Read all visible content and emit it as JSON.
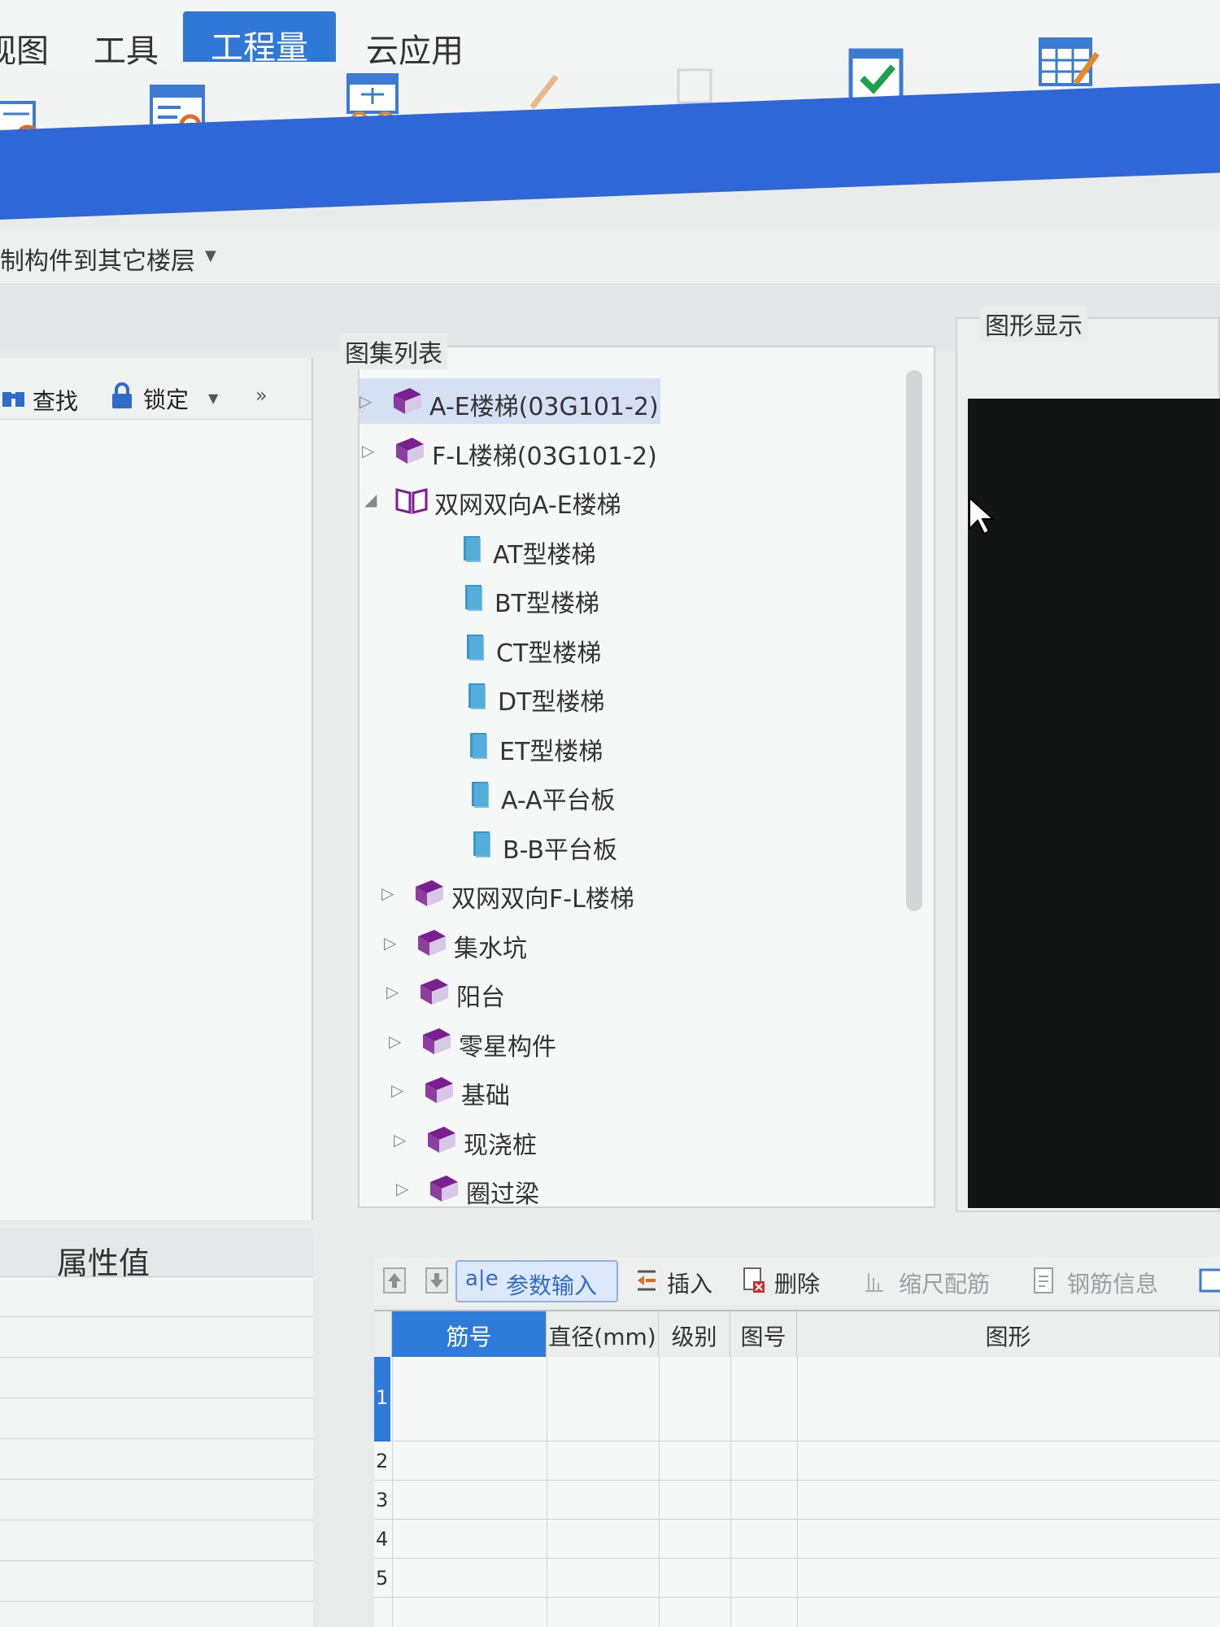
{
  "menu": {
    "items": [
      {
        "label": "视图"
      },
      {
        "label": "工具"
      },
      {
        "label": "工程量"
      },
      {
        "label": "云应用"
      }
    ]
  },
  "toolbar": {
    "icons": [
      "find-drawing-icon",
      "query-table-icon",
      "calculator-glasses-icon",
      "pencil-icon",
      "blank-icon",
      "check-icon",
      "table-edit-icon"
    ]
  },
  "copy_row": {
    "label": "制构件到其它楼层"
  },
  "left_panel": {
    "find_label": "查找",
    "lock_label": "锁定"
  },
  "attribute_panel": {
    "title": "属性值"
  },
  "atlas": {
    "title": "图集列表",
    "items": [
      {
        "label": "A-E楼梯(03G101-2)",
        "expanded": false,
        "selected": true
      },
      {
        "label": "F-L楼梯(03G101-2)",
        "expanded": false
      },
      {
        "label": "双网双向A-E楼梯",
        "expanded": true,
        "children": [
          {
            "label": "AT型楼梯"
          },
          {
            "label": "BT型楼梯"
          },
          {
            "label": "CT型楼梯"
          },
          {
            "label": "DT型楼梯"
          },
          {
            "label": "ET型楼梯"
          },
          {
            "label": "A-A平台板"
          },
          {
            "label": "B-B平台板"
          }
        ]
      },
      {
        "label": "双网双向F-L楼梯",
        "expanded": false
      },
      {
        "label": "集水坑",
        "expanded": false
      },
      {
        "label": "阳台",
        "expanded": false
      },
      {
        "label": "零星构件",
        "expanded": false
      },
      {
        "label": "基础",
        "expanded": false
      },
      {
        "label": "现浇桩",
        "expanded": false
      },
      {
        "label": "圈过梁",
        "expanded": false
      }
    ]
  },
  "graphic_display": {
    "title": "图形显示"
  },
  "rebar_toolbar": {
    "param_input": "参数输入",
    "insert": "插入",
    "delete": "删除",
    "scale_rebar": "缩尺配筋",
    "rebar_info": "钢筋信息"
  },
  "rebar_grid": {
    "columns": [
      "筋号",
      "直径(mm)",
      "级别",
      "图号",
      "图形"
    ],
    "rows": [
      "1",
      "2",
      "3",
      "4",
      "5"
    ]
  },
  "colors": {
    "accent_blue": "#2f67d9",
    "tab_active": "#2f78d8",
    "book_purple": "#7a1f8f",
    "canvas": "#131514"
  }
}
